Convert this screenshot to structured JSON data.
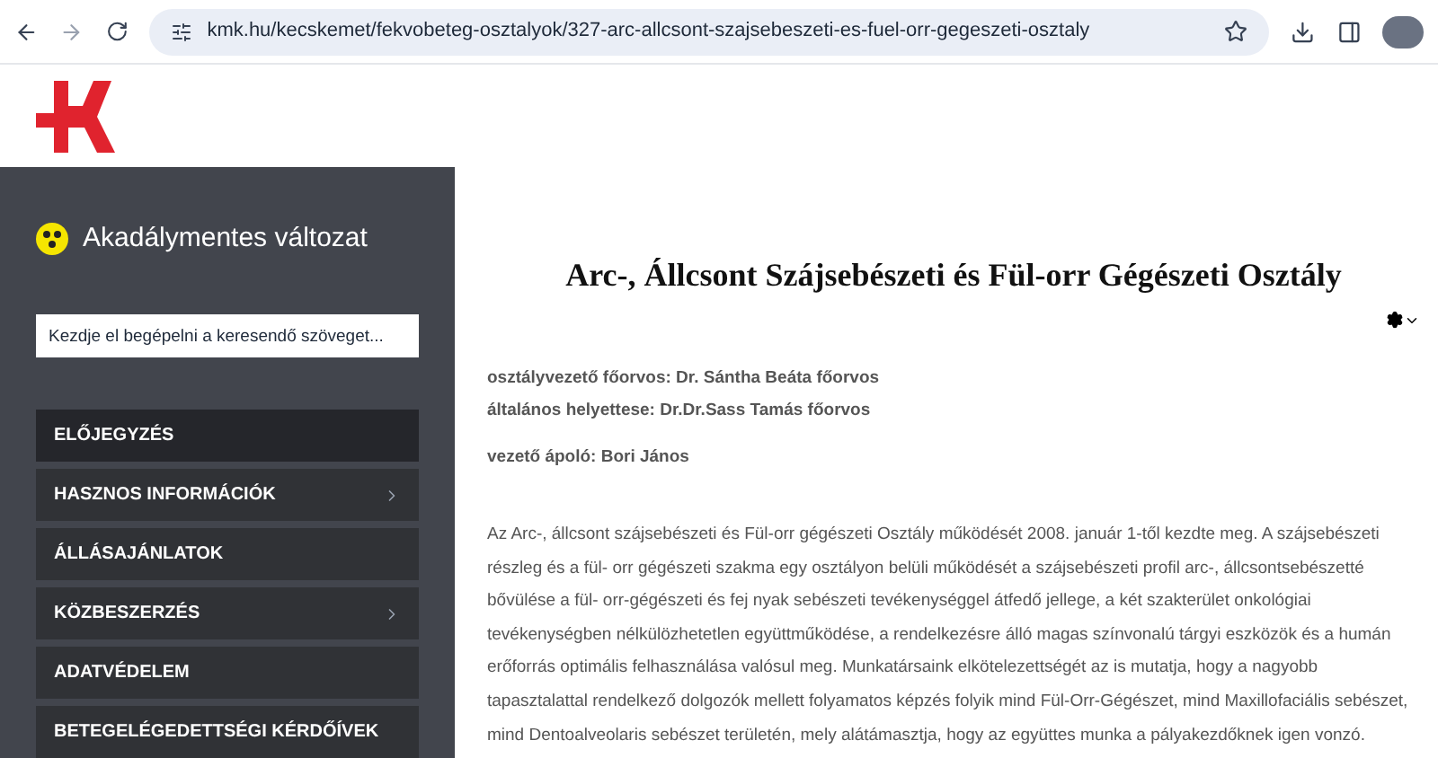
{
  "browser": {
    "url": "kmk.hu/kecskemet/fekvobeteg-osztalyok/327-arc-allcsont-szajsebeszeti-es-fuel-orr-gegeszeti-osztaly"
  },
  "sidebar": {
    "accessibility_link": "Akadálymentes változat",
    "search": {
      "placeholder": "Kezdje el begépelni a keresendő szöveget..."
    },
    "menu": [
      {
        "label": "ELŐJEGYZÉS",
        "selected": true,
        "submenu": false
      },
      {
        "label": "HASZNOS INFORMÁCIÓK",
        "selected": false,
        "submenu": true
      },
      {
        "label": "ÁLLÁSAJÁNLATOK",
        "selected": false,
        "submenu": false
      },
      {
        "label": "KÖZBESZERZÉS",
        "selected": false,
        "submenu": true
      },
      {
        "label": "ADATVÉDELEM",
        "selected": false,
        "submenu": false
      },
      {
        "label": "BETEGELÉGEDETTSÉGI KÉRDŐÍVEK",
        "selected": false,
        "submenu": false
      }
    ]
  },
  "article": {
    "title": "Arc-, Állcsont Szájsebészeti és Fül-orr Gégészeti Osztály",
    "staff": [
      "osztályvezető főorvos: Dr. Sántha Beáta főorvos",
      "általános helyettese: Dr.Dr.Sass Tamás főorvos",
      "vezető ápoló: Bori János"
    ],
    "body": "Az Arc-, állcsont szájsebészeti és Fül-orr gégészeti Osztály működését 2008. január 1-től kezdte meg. A szájsebészeti részleg és a fül- orr gégészeti szakma egy osztályon belüli működését a szájsebészeti profil arc-, állcsontsebészetté bővülése a fül- orr-gégészeti és fej nyak sebészeti tevékenységgel átfedő jellege, a két szakterület onkológiai tevékenységben nélkülözhetetlen együttműködése, a rendelkezésre álló magas színvonalú tárgyi eszközök és a humán erőforrás optimális felhasználása  valósul meg. Munkatársaink elkötelezettségét az is mutatja, hogy a nagyobb tapasztalattal rendelkező dolgozók mellett folyamatos képzés folyik mind Fül-Orr-Gégészet, mind Maxillofaciális sebészet, mind Dentoalveolaris sebészet területén, mely alátámasztja, hogy az együttes munka a pályakezdőknek igen vonzó."
  }
}
